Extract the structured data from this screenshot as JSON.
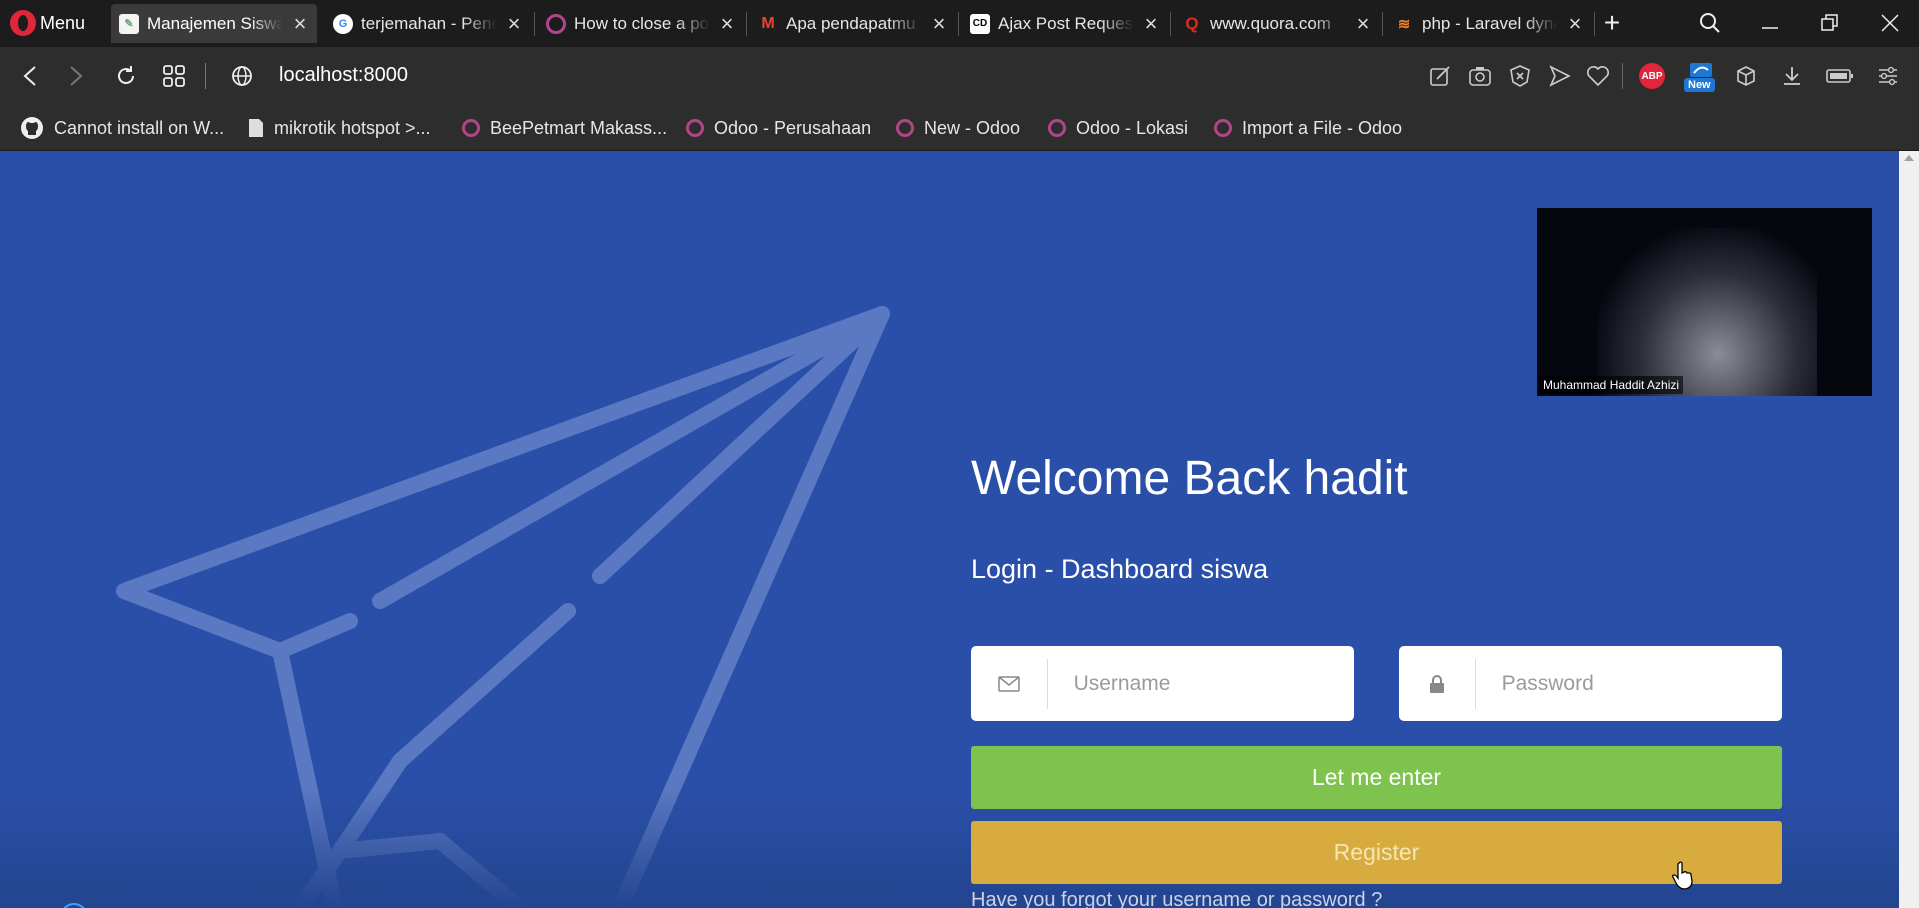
{
  "browser": {
    "menu_label": "Menu",
    "tabs": [
      {
        "title": "Manajemen Siswa",
        "active": true
      },
      {
        "title": "terjemahan - Penelusuran Google",
        "active": false
      },
      {
        "title": "How to close a popup",
        "active": false
      },
      {
        "title": "Apa pendapatmu",
        "active": false
      },
      {
        "title": "Ajax Post Request",
        "active": false
      },
      {
        "title": "www.quora.com",
        "active": false
      },
      {
        "title": "php - Laravel dynamic",
        "active": false
      }
    ],
    "url": "localhost:8000",
    "extensions": {
      "abp": "ABP",
      "new_badge": "New"
    },
    "bookmarks": [
      {
        "label": "Cannot install on W...",
        "icon": "github-icon"
      },
      {
        "label": "mikrotik hotspot >...",
        "icon": "file-icon"
      },
      {
        "label": "BeePetmart Makass...",
        "icon": "odoo-icon"
      },
      {
        "label": "Odoo - Perusahaan",
        "icon": "odoo-icon"
      },
      {
        "label": "New - Odoo",
        "icon": "odoo-icon"
      },
      {
        "label": "Odoo - Lokasi",
        "icon": "odoo-icon"
      },
      {
        "label": "Import a File - Odoo",
        "icon": "odoo-icon"
      }
    ]
  },
  "login": {
    "heading": "Welcome Back hadit",
    "subheading": "Login - Dashboard siswa",
    "username_placeholder": "Username",
    "password_placeholder": "Password",
    "enter_label": "Let me enter",
    "register_label": "Register",
    "forgot_label": "Have you forgot your username or password ?"
  },
  "video_overlay": {
    "participant_name": "Muhammad Haddit Azhizi"
  },
  "colors": {
    "page_bg": "#2a4fa8",
    "enter_btn": "#7dc34d",
    "register_btn": "#d7ab3e"
  }
}
